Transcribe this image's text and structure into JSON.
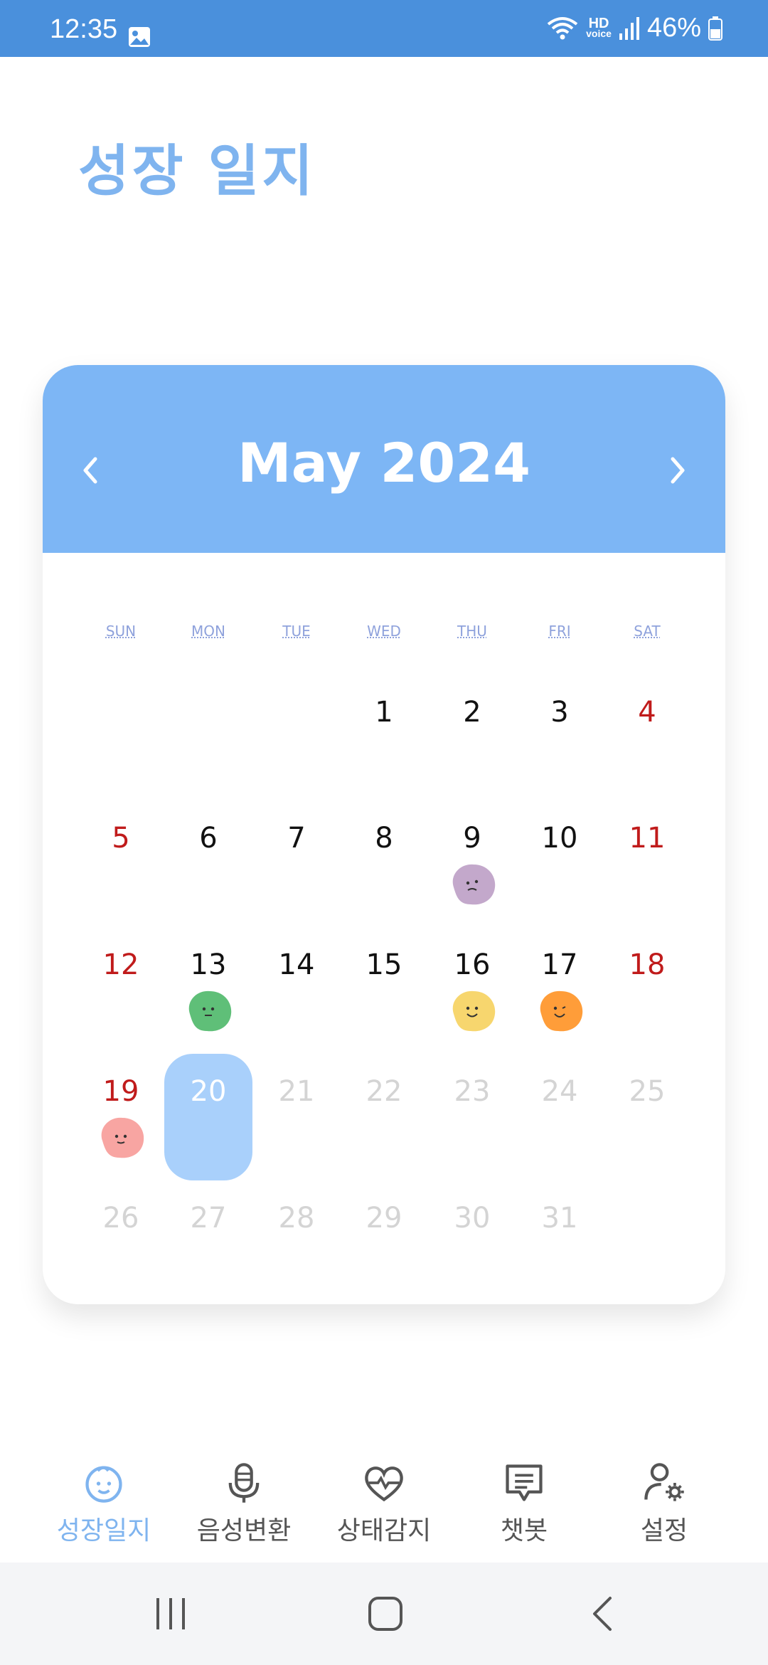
{
  "status_bar": {
    "time": "12:35",
    "battery": "46%",
    "hd_label": "HD",
    "voice_label": "voice"
  },
  "page_title": "성장 일지",
  "calendar": {
    "month_label": "May 2024",
    "weekdays": [
      "SUN",
      "MON",
      "TUE",
      "WED",
      "THU",
      "FRI",
      "SAT"
    ],
    "today": 20,
    "days": [
      "1",
      "2",
      "3",
      "4",
      "5",
      "6",
      "7",
      "8",
      "9",
      "10",
      "11",
      "12",
      "13",
      "14",
      "15",
      "16",
      "17",
      "18",
      "19",
      "20",
      "21",
      "22",
      "23",
      "24",
      "25",
      "26",
      "27",
      "28",
      "29",
      "30",
      "31"
    ],
    "moods": [
      {
        "day": 9,
        "color": "#c3a8cb",
        "mood": "sad"
      },
      {
        "day": 13,
        "color": "#5fbf78",
        "mood": "calm"
      },
      {
        "day": 16,
        "color": "#f7d66e",
        "mood": "happy"
      },
      {
        "day": 17,
        "color": "#ff9d39",
        "mood": "joyful"
      },
      {
        "day": 19,
        "color": "#f8a5a2",
        "mood": "content"
      }
    ]
  },
  "bottom_nav": {
    "items": [
      {
        "label": "성장일지",
        "icon": "baby-face-icon",
        "active": true
      },
      {
        "label": "음성변환",
        "icon": "microphone-icon",
        "active": false
      },
      {
        "label": "상태감지",
        "icon": "heart-pulse-icon",
        "active": false
      },
      {
        "label": "챗봇",
        "icon": "chat-bubble-icon",
        "active": false
      },
      {
        "label": "설정",
        "icon": "user-settings-icon",
        "active": false
      }
    ]
  },
  "colors": {
    "accent": "#7db6f5",
    "status_bar": "#4a90dc",
    "active_nav": "#7fb4ef",
    "inactive_nav": "#555555",
    "weekend": "#c01b1b"
  }
}
